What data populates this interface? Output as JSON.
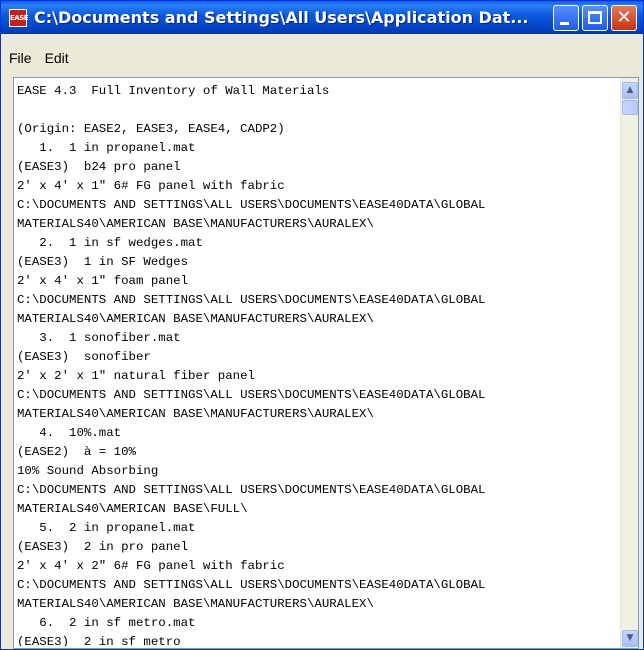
{
  "window": {
    "title": "C:\\Documents and Settings\\All Users\\Application Dat...",
    "app_icon_label": "EASE"
  },
  "menu": {
    "items": [
      "File",
      "Edit"
    ]
  },
  "content": {
    "lines": [
      "EASE 4.3  Full Inventory of Wall Materials",
      "",
      "(Origin: EASE2, EASE3, EASE4, CADP2)",
      "   1.  1 in propanel.mat",
      "(EASE3)  b24 pro panel",
      "2' x 4' x 1\" 6# FG panel with fabric",
      "C:\\DOCUMENTS AND SETTINGS\\ALL USERS\\DOCUMENTS\\EASE40DATA\\GLOBAL",
      "MATERIALS40\\AMERICAN BASE\\MANUFACTURERS\\AURALEX\\",
      "   2.  1 in sf wedges.mat",
      "(EASE3)  1 in SF Wedges",
      "2' x 4' x 1\" foam panel",
      "C:\\DOCUMENTS AND SETTINGS\\ALL USERS\\DOCUMENTS\\EASE40DATA\\GLOBAL",
      "MATERIALS40\\AMERICAN BASE\\MANUFACTURERS\\AURALEX\\",
      "   3.  1 sonofiber.mat",
      "(EASE3)  sonofiber",
      "2' x 2' x 1\" natural fiber panel",
      "C:\\DOCUMENTS AND SETTINGS\\ALL USERS\\DOCUMENTS\\EASE40DATA\\GLOBAL",
      "MATERIALS40\\AMERICAN BASE\\MANUFACTURERS\\AURALEX\\",
      "   4.  10%.mat",
      "(EASE2)  à = 10%",
      "10% Sound Absorbing",
      "C:\\DOCUMENTS AND SETTINGS\\ALL USERS\\DOCUMENTS\\EASE40DATA\\GLOBAL",
      "MATERIALS40\\AMERICAN BASE\\FULL\\",
      "   5.  2 in propanel.mat",
      "(EASE3)  2 in pro panel",
      "2' x 4' x 2\" 6# FG panel with fabric",
      "C:\\DOCUMENTS AND SETTINGS\\ALL USERS\\DOCUMENTS\\EASE40DATA\\GLOBAL",
      "MATERIALS40\\AMERICAN BASE\\MANUFACTURERS\\AURALEX\\",
      "   6.  2 in sf metro.mat",
      "(EASE3)  2 in sf metro"
    ]
  },
  "icons": {
    "minimize": "minimize-icon",
    "maximize": "maximize-icon",
    "close": "close-icon",
    "scroll_up": "scroll-up-arrow-icon",
    "scroll_down": "scroll-down-arrow-icon"
  },
  "colors": {
    "titlebar": "#0a58de",
    "close_button": "#c2350f",
    "window_frame": "#ece9d8"
  }
}
